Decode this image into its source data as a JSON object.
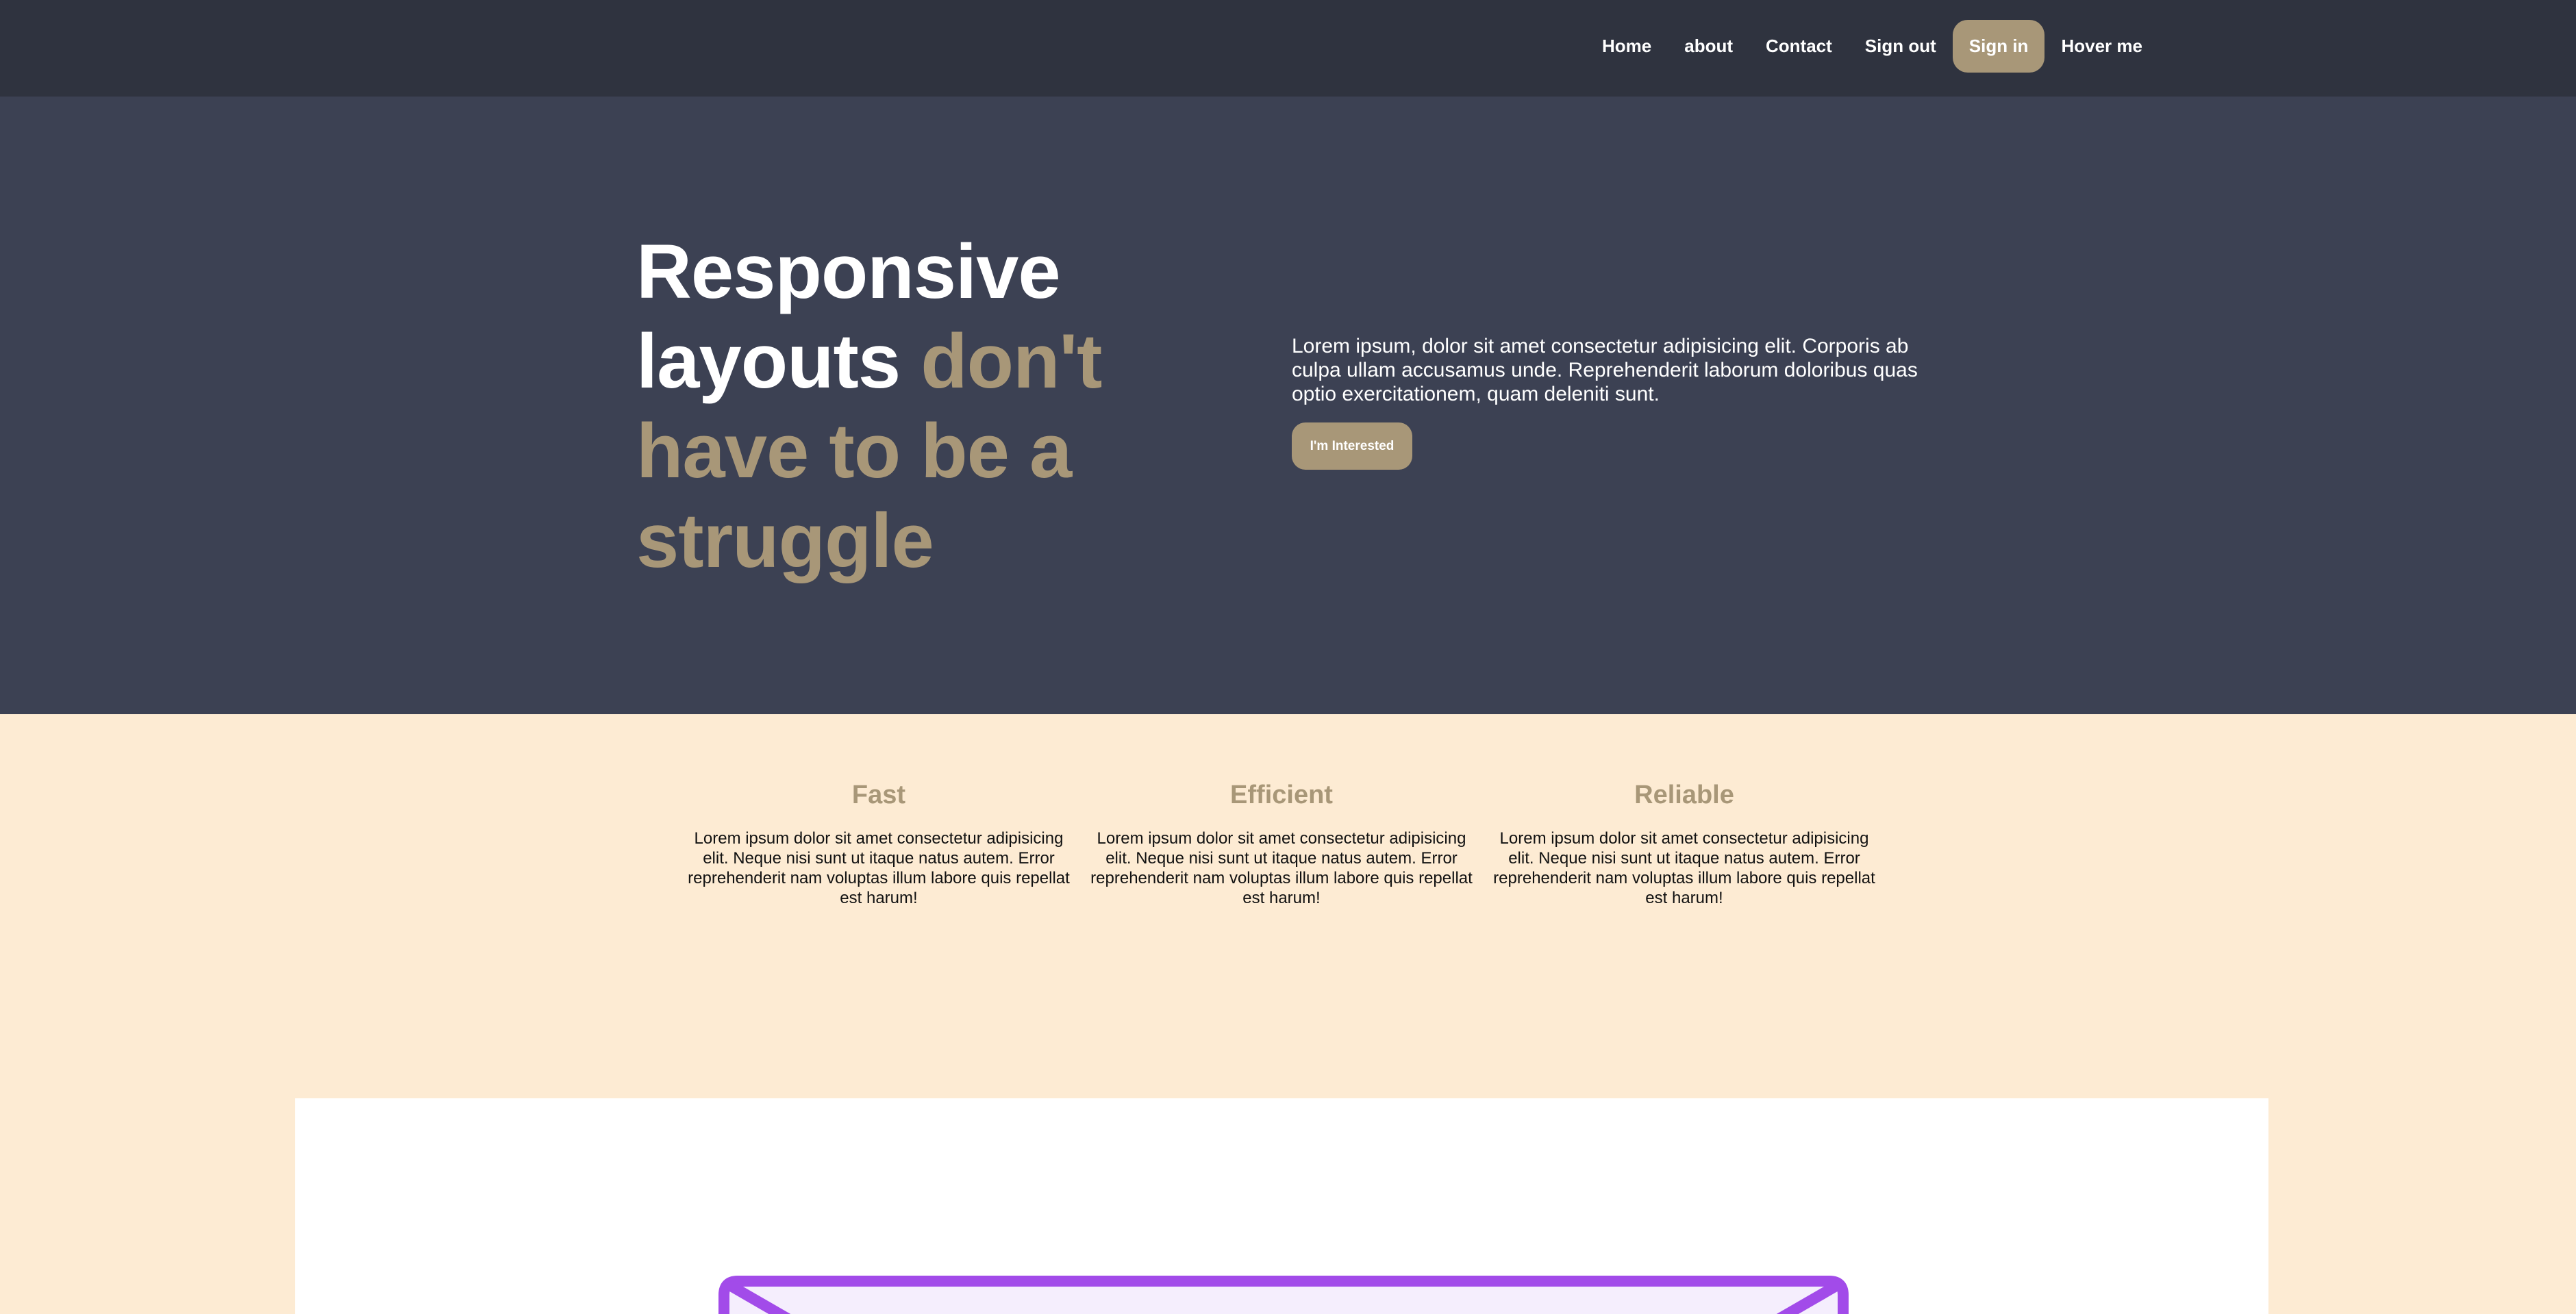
{
  "nav": {
    "items": [
      {
        "label": "Home",
        "active": false
      },
      {
        "label": "about",
        "active": false
      },
      {
        "label": "Contact",
        "active": false
      },
      {
        "label": "Sign out",
        "active": false
      },
      {
        "label": "Sign in",
        "active": true
      },
      {
        "label": "Hover me",
        "active": false
      }
    ]
  },
  "hero": {
    "title_line1": "Responsive",
    "title_line2_white": "layouts ",
    "title_line2_accent": "don't",
    "title_line3": "have to be a",
    "title_line4": "struggle",
    "text": "Lorem ipsum, dolor sit amet consectetur adipisicing elit. Corporis ab culpa ullam accusamus unde. Reprehenderit laborum doloribus quas optio exercitationem, quam deleniti sunt.",
    "cta_label": "I'm Interested"
  },
  "features": [
    {
      "title": "Fast",
      "text": "Lorem ipsum dolor sit amet consectetur adipisicing elit. Neque nisi sunt ut itaque natus autem. Error reprehenderit nam voluptas illum labore quis repellat est harum!"
    },
    {
      "title": "Efficient",
      "text": "Lorem ipsum dolor sit amet consectetur adipisicing elit. Neque nisi sunt ut itaque natus autem. Error reprehenderit nam voluptas illum labore quis repellat est harum!"
    },
    {
      "title": "Reliable",
      "text": "Lorem ipsum dolor sit amet consectetur adipisicing elit. Neque nisi sunt ut itaque natus autem. Error reprehenderit nam voluptas illum labore quis repellat est harum!"
    }
  ],
  "illustration": {
    "icon": "envelope-icon"
  },
  "colors": {
    "header_bg": "#2f333f",
    "hero_bg": "#3c4153",
    "accent": "#a89778",
    "page_bg": "#fdebd3",
    "envelope_stroke": "#a24be9",
    "envelope_fill": "#f5eefd"
  }
}
